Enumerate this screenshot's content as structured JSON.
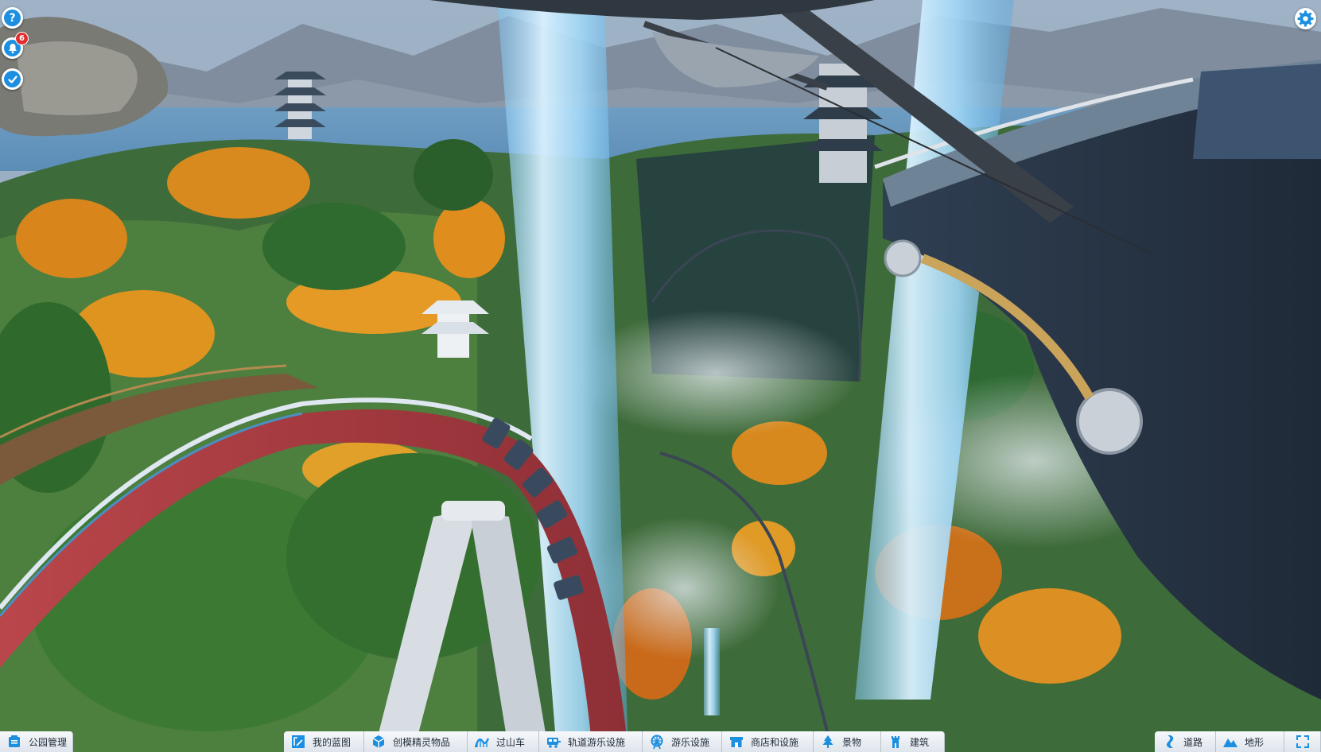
{
  "hud": {
    "help_glyph": "?",
    "notification_count": "6"
  },
  "toolbar": {
    "park_management": "公园管理",
    "my_blueprints": "我的蓝图",
    "scenery_objects": "创模精灵物品",
    "coasters": "过山车",
    "track_rides": "轨道游乐设施",
    "flat_rides": "游乐设施",
    "shops_facilities": "商店和设施",
    "scenery": "景物",
    "building": "建筑",
    "paths": "道路",
    "terrain": "地形"
  },
  "colors": {
    "accent": "#1d8fe0",
    "badge": "#e02d2d",
    "toolbar_bg": "#e8edf2",
    "toolbar_text": "#1d2a38"
  }
}
